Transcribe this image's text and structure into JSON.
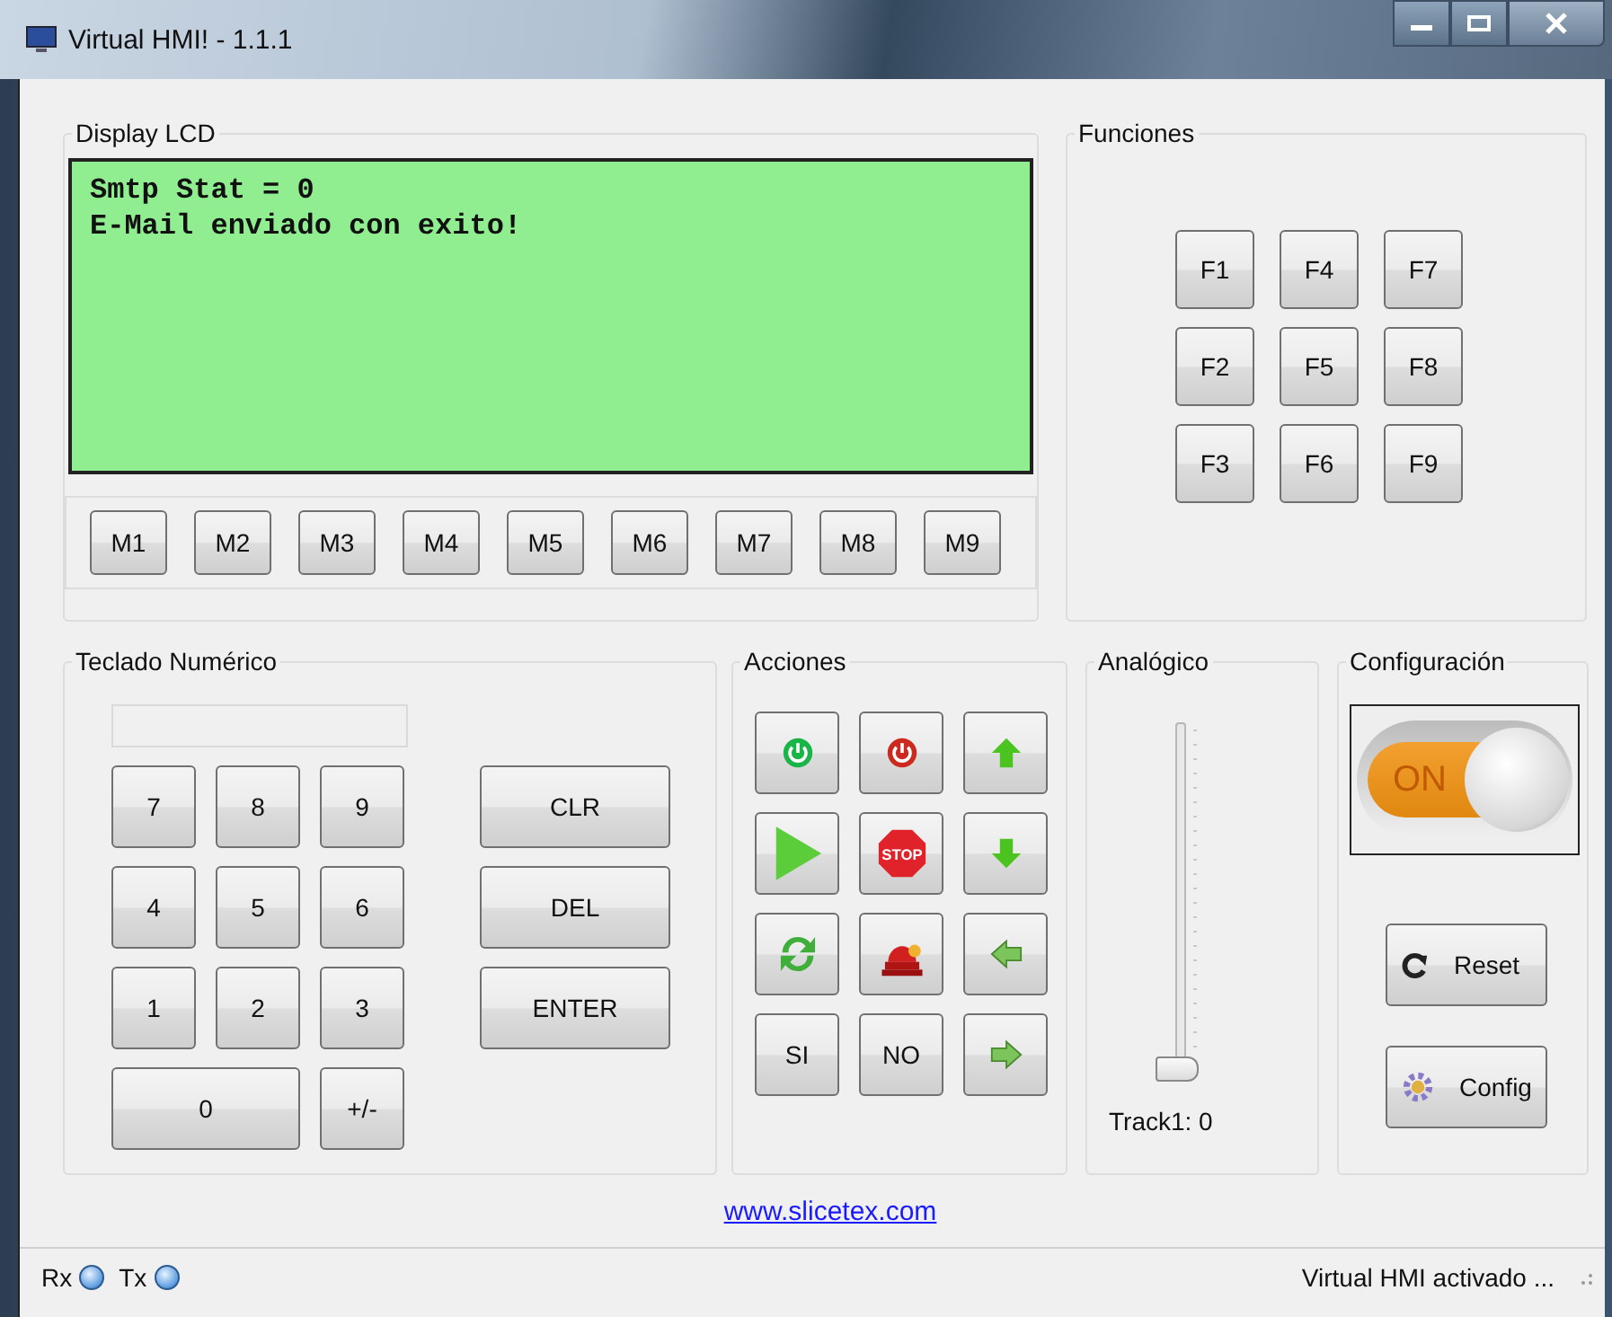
{
  "window": {
    "title": "Virtual HMI! - 1.1.1"
  },
  "lcd": {
    "title": "Display LCD",
    "lines": [
      "Smtp Stat = 0",
      "E-Mail enviado con exito!"
    ],
    "memory_buttons": [
      "M1",
      "M2",
      "M3",
      "M4",
      "M5",
      "M6",
      "M7",
      "M8",
      "M9"
    ]
  },
  "funciones": {
    "title": "Funciones",
    "buttons": [
      "F1",
      "F4",
      "F7",
      "F2",
      "F5",
      "F8",
      "F3",
      "F6",
      "F9"
    ]
  },
  "keypad": {
    "title": "Teclado Numérico",
    "keys": [
      "7",
      "8",
      "9",
      "4",
      "5",
      "6",
      "1",
      "2",
      "3",
      "0",
      "+/-"
    ],
    "side_keys": [
      "CLR",
      "DEL",
      "ENTER"
    ]
  },
  "acciones": {
    "title": "Acciones",
    "buttons": [
      {
        "kind": "power_on"
      },
      {
        "kind": "power_off"
      },
      {
        "kind": "up"
      },
      {
        "kind": "play"
      },
      {
        "kind": "stop",
        "label": "STOP"
      },
      {
        "kind": "down"
      },
      {
        "kind": "refresh"
      },
      {
        "kind": "alarm"
      },
      {
        "kind": "left"
      },
      {
        "kind": "text",
        "label": "SI"
      },
      {
        "kind": "text",
        "label": "NO"
      },
      {
        "kind": "right"
      }
    ]
  },
  "analog": {
    "title": "Analógico",
    "level": 0,
    "reading": "Track1: 0"
  },
  "config": {
    "title": "Configuración",
    "toggle": {
      "on": true,
      "label": "ON"
    },
    "buttons": [
      {
        "kind": "reset",
        "label": "Reset"
      },
      {
        "kind": "config",
        "label": "Config"
      }
    ]
  },
  "link": "www.slicetex.com",
  "status_bar": {
    "rx_label": "Rx",
    "tx_label": "Tx",
    "message": "Virtual HMI activado ..."
  }
}
